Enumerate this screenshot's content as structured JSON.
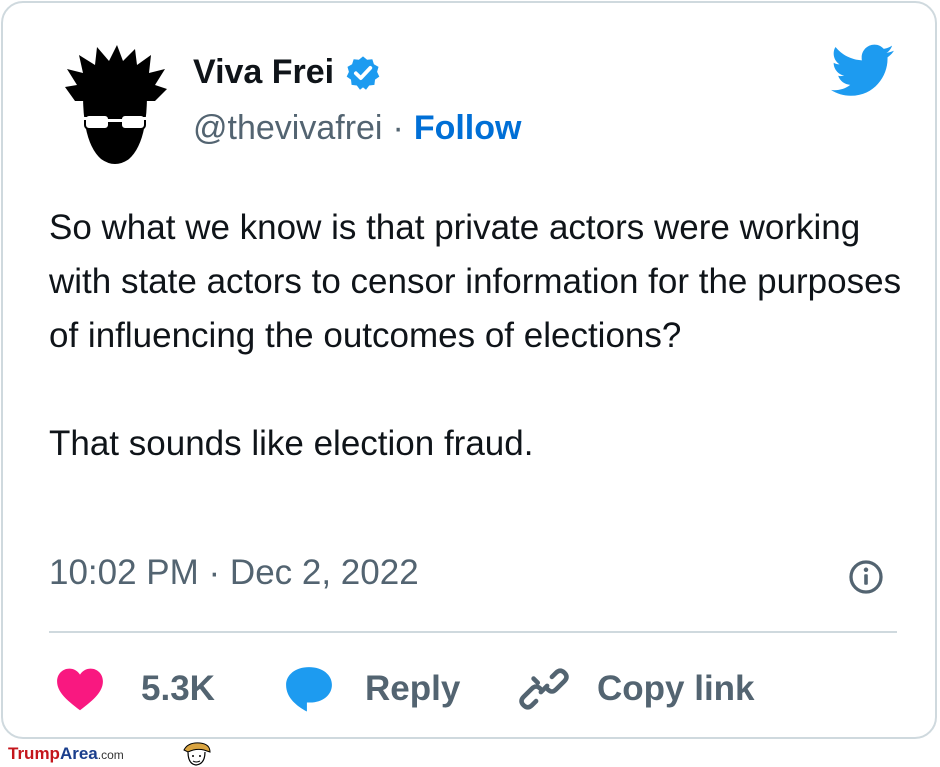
{
  "tweet": {
    "author_name": "Viva Frei",
    "handle": "@thevivafrei",
    "separator": "·",
    "follow_label": "Follow",
    "paragraphs": [
      "So what we know is that private actors were working with state actors to censor information for the purposes of influencing the outcomes of elections?",
      "That sounds like election fraud."
    ],
    "timestamp": "10:02 PM · Dec 2, 2022"
  },
  "actions": {
    "likes_count": "5.3K",
    "reply_label": "Reply",
    "copy_link_label": "Copy link"
  },
  "watermark": {
    "part1": "Trump",
    "part2": "Area",
    "part3": ".com"
  },
  "colors": {
    "accent": "#1d9bf0",
    "follow": "#006fd6",
    "like": "#f91880",
    "muted_text": "#536471",
    "primary_text": "#0f1419",
    "border": "#cfd9de"
  },
  "icons": [
    "avatar-icon",
    "verified-badge-icon",
    "twitter-bird-icon",
    "info-icon",
    "heart-icon",
    "reply-bubble-icon",
    "link-icon"
  ]
}
